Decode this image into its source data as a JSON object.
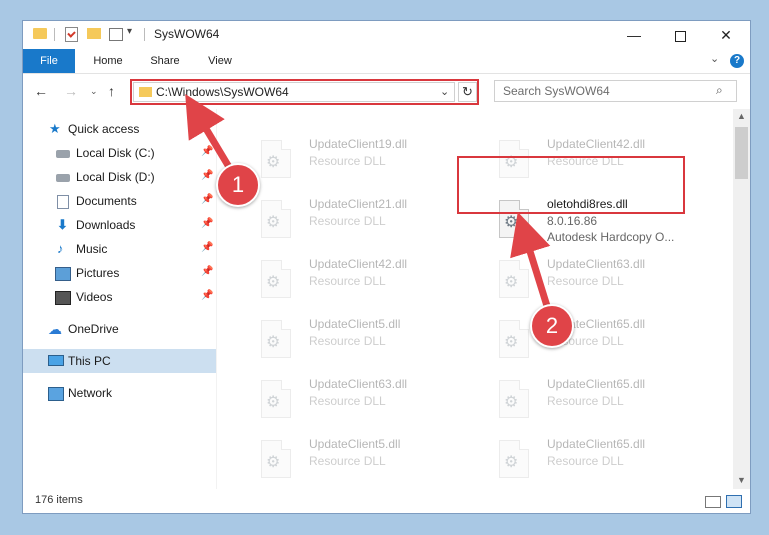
{
  "window": {
    "title": "SysWOW64",
    "controls": {
      "minimize": "—",
      "close": "✕"
    }
  },
  "quick_access_toolbar": {
    "arrow": "▾"
  },
  "ribbon": {
    "tabs": [
      "File",
      "Home",
      "Share",
      "View"
    ],
    "collapse": "⌄",
    "help": "?"
  },
  "nav": {
    "back": "←",
    "forward": "→",
    "recent": "⌄",
    "up": "↑",
    "address": "C:\\Windows\\SysWOW64",
    "address_dropdown": "⌄",
    "refresh": "↻",
    "search_placeholder": "Search SysWOW64",
    "search_icon": "⌕"
  },
  "sidebar": {
    "pin_glyph": "📌",
    "items": [
      {
        "label": "Quick access",
        "icon": "star-icon"
      },
      {
        "label": "Local Disk (C:)",
        "icon": "disk-icon",
        "pinned": true
      },
      {
        "label": "Local Disk (D:)",
        "icon": "disk-icon",
        "pinned": true
      },
      {
        "label": "Documents",
        "icon": "documents-icon",
        "pinned": true
      },
      {
        "label": "Downloads",
        "icon": "download-icon",
        "pinned": true
      },
      {
        "label": "Music",
        "icon": "music-icon",
        "pinned": true
      },
      {
        "label": "Pictures",
        "icon": "pictures-icon",
        "pinned": true
      },
      {
        "label": "Videos",
        "icon": "videos-icon",
        "pinned": true
      },
      {
        "label": "OneDrive",
        "icon": "cloud-icon"
      },
      {
        "label": "This PC",
        "icon": "computer-icon",
        "selected": true
      },
      {
        "label": "Network",
        "icon": "network-icon"
      }
    ]
  },
  "files": {
    "left_column": [
      {
        "name": "UpdateClient19.dll",
        "type": "Resource DLL"
      },
      {
        "name": "UpdateClient21.dll",
        "type": "Resource DLL"
      },
      {
        "name": "UpdateClient42.dll",
        "type": "Resource DLL"
      },
      {
        "name": "UpdateClient5.dll",
        "type": "Resource DLL"
      },
      {
        "name": "UpdateClient63.dll",
        "type": "Resource DLL"
      },
      {
        "name": "UpdateClient5.dll",
        "type": "Resource DLL"
      }
    ],
    "right_column": [
      {
        "name": "UpdateClient42.dll",
        "type": "Resource DLL"
      },
      {
        "name": "oletohdi8res.dll",
        "version": "8.0.16.86",
        "description": "Autodesk Hardcopy O...",
        "highlighted": true
      },
      {
        "name": "UpdateClient63.dll",
        "type": "Resource DLL"
      },
      {
        "name": "UpdateClient65.dll",
        "type": "Resource DLL"
      },
      {
        "name": "UpdateClient65.dll",
        "type": "Resource DLL"
      },
      {
        "name": "UpdateClient65.dll",
        "type": "Resource DLL"
      }
    ]
  },
  "scrollbar": {
    "up": "▲",
    "down": "▼"
  },
  "status": {
    "item_count": "176 items"
  },
  "annotations": [
    {
      "label": "1"
    },
    {
      "label": "2"
    }
  ],
  "colors": {
    "accent": "#1979ca",
    "highlight": "#d9373d",
    "badge": "#e04448",
    "selection": "#ccdff0"
  }
}
